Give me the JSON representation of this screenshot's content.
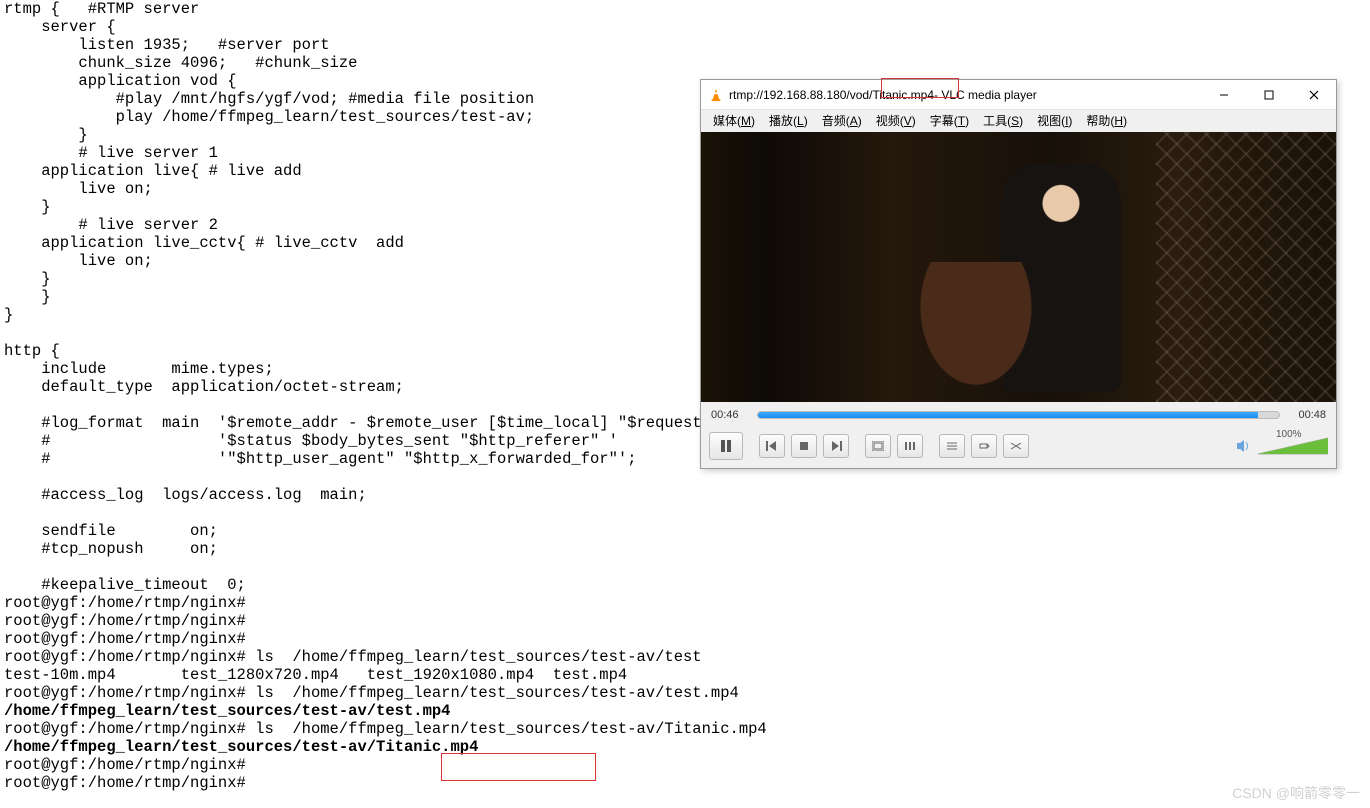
{
  "config_lines": [
    "rtmp {   #RTMP server",
    "    server {",
    "        listen 1935;   #server port",
    "        chunk_size 4096;   #chunk_size",
    "        application vod {",
    "            #play /mnt/hgfs/ygf/vod; #media file position",
    "            play /home/ffmpeg_learn/test_sources/test-av;",
    "        }",
    "        # live server 1",
    "    application live{ # live add",
    "        live on;",
    "    }",
    "        # live server 2",
    "    application live_cctv{ # live_cctv  add",
    "        live on;",
    "    }",
    "    }",
    "}",
    "",
    "http {",
    "    include       mime.types;",
    "    default_type  application/octet-stream;",
    "",
    "    #log_format  main  '$remote_addr - $remote_user [$time_local] \"$request\" '",
    "    #                  '$status $body_bytes_sent \"$http_referer\" '",
    "    #                  '\"$http_user_agent\" \"$http_x_forwarded_for\"';",
    "",
    "    #access_log  logs/access.log  main;",
    "",
    "    sendfile        on;",
    "    #tcp_nopush     on;",
    "",
    "    #keepalive_timeout  0;"
  ],
  "prompt": "root@ygf:/home/rtmp/nginx#",
  "shell_lines": [
    {
      "cmd": ""
    },
    {
      "cmd": ""
    },
    {
      "cmd": ""
    },
    {
      "cmd": " ls  /home/ffmpeg_learn/test_sources/test-av/test"
    },
    {
      "out": "test-10m.mp4       test_1280x720.mp4   test_1920x1080.mp4  test.mp4"
    },
    {
      "cmd": " ls  /home/ffmpeg_learn/test_sources/test-av/test.mp4"
    },
    {
      "bold_out": "/home/ffmpeg_learn/test_sources/test-av/test.mp4"
    },
    {
      "cmd": " ls  /home/ffmpeg_learn/test_sources/test-av/Titanic.mp4"
    },
    {
      "bold_out": "/home/ffmpeg_learn/test_sources/test-av/Titanic.mp4"
    },
    {
      "cmd": ""
    },
    {
      "cmd": ""
    }
  ],
  "vlc": {
    "title_pre": "rtmp://192.168.88.180/vod",
    "title_file": "/Titanic.mp4",
    "title_suffix": " - VLC media player",
    "menus": [
      {
        "label": "媒体",
        "hot": "M"
      },
      {
        "label": "播放",
        "hot": "L"
      },
      {
        "label": "音频",
        "hot": "A"
      },
      {
        "label": "视频",
        "hot": "V"
      },
      {
        "label": "字幕",
        "hot": "T"
      },
      {
        "label": "工具",
        "hot": "S"
      },
      {
        "label": "视图",
        "hot": "I"
      },
      {
        "label": "帮助",
        "hot": "H"
      }
    ],
    "time_current": "00:46",
    "time_total": "00:48",
    "volume_pct": "100%"
  },
  "watermark": "CSDN @响箭零零一"
}
